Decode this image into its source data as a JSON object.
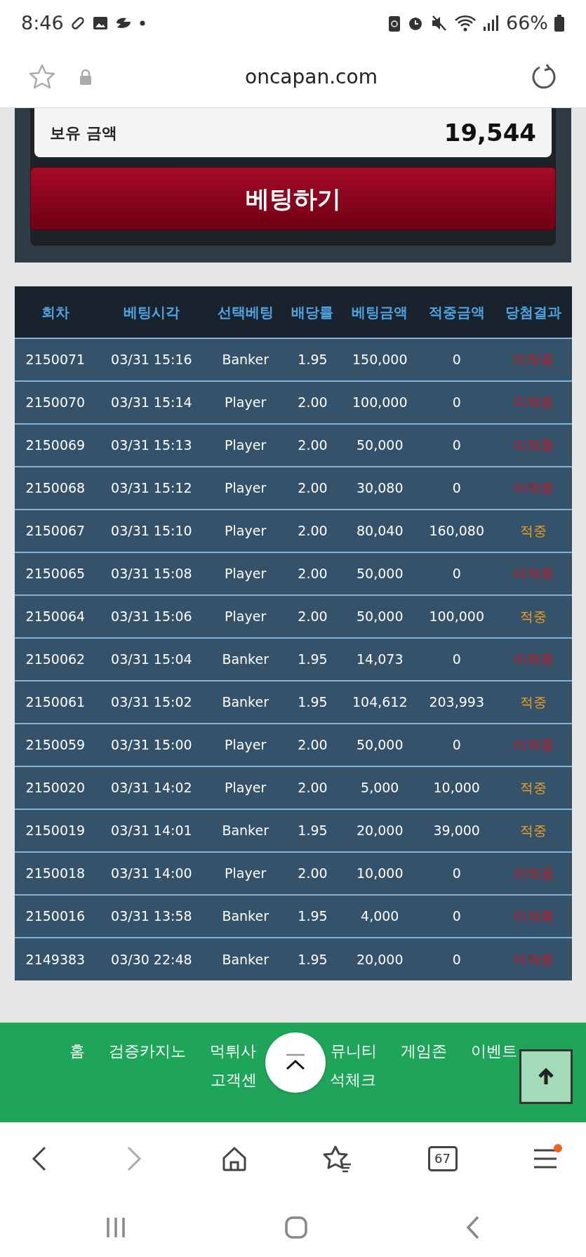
{
  "status_bar": {
    "time": "8:46",
    "battery": "66%"
  },
  "browser": {
    "url": "oncapan.com",
    "tab_count": "67",
    "menu_notification": true
  },
  "balance": {
    "label": "보유 금액",
    "value": "19,544"
  },
  "bet_button": "베팅하기",
  "table": {
    "columns": [
      "회차",
      "베팅시각",
      "선택베팅",
      "배당률",
      "베팅금액",
      "적중금액",
      "당첨결과"
    ],
    "rows": [
      {
        "cells": [
          "2150071",
          "03/31 15:16",
          "Banker",
          "1.95",
          "150,000",
          "0"
        ],
        "result": "미적중",
        "won": false
      },
      {
        "cells": [
          "2150070",
          "03/31 15:14",
          "Player",
          "2.00",
          "100,000",
          "0"
        ],
        "result": "미적중",
        "won": false
      },
      {
        "cells": [
          "2150069",
          "03/31 15:13",
          "Player",
          "2.00",
          "50,000",
          "0"
        ],
        "result": "미적중",
        "won": false
      },
      {
        "cells": [
          "2150068",
          "03/31 15:12",
          "Player",
          "2.00",
          "30,080",
          "0"
        ],
        "result": "미적중",
        "won": false
      },
      {
        "cells": [
          "2150067",
          "03/31 15:10",
          "Player",
          "2.00",
          "80,040",
          "160,080"
        ],
        "result": "적중",
        "won": true
      },
      {
        "cells": [
          "2150065",
          "03/31 15:08",
          "Player",
          "2.00",
          "50,000",
          "0"
        ],
        "result": "미적중",
        "won": false
      },
      {
        "cells": [
          "2150064",
          "03/31 15:06",
          "Player",
          "2.00",
          "50,000",
          "100,000"
        ],
        "result": "적중",
        "won": true
      },
      {
        "cells": [
          "2150062",
          "03/31 15:04",
          "Banker",
          "1.95",
          "14,073",
          "0"
        ],
        "result": "미적중",
        "won": false
      },
      {
        "cells": [
          "2150061",
          "03/31 15:02",
          "Banker",
          "1.95",
          "104,612",
          "203,993"
        ],
        "result": "적중",
        "won": true
      },
      {
        "cells": [
          "2150059",
          "03/31 15:00",
          "Player",
          "2.00",
          "50,000",
          "0"
        ],
        "result": "미적중",
        "won": false
      },
      {
        "cells": [
          "2150020",
          "03/31 14:02",
          "Player",
          "2.00",
          "5,000",
          "10,000"
        ],
        "result": "적중",
        "won": true
      },
      {
        "cells": [
          "2150019",
          "03/31 14:01",
          "Banker",
          "1.95",
          "20,000",
          "39,000"
        ],
        "result": "적중",
        "won": true
      },
      {
        "cells": [
          "2150018",
          "03/31 14:00",
          "Player",
          "2.00",
          "10,000",
          "0"
        ],
        "result": "미적중",
        "won": false
      },
      {
        "cells": [
          "2150016",
          "03/31 13:58",
          "Banker",
          "1.95",
          "4,000",
          "0"
        ],
        "result": "미적중",
        "won": false
      },
      {
        "cells": [
          "2149383",
          "03/30 22:48",
          "Banker",
          "1.95",
          "20,000",
          "0"
        ],
        "result": "미적중",
        "won": false
      }
    ]
  },
  "footer": {
    "links": [
      [
        "홈",
        "검증카지노",
        "먹튀사",
        "뮤니티",
        "게임존",
        "이벤트"
      ],
      [
        "고객센",
        "석체크"
      ]
    ]
  }
}
